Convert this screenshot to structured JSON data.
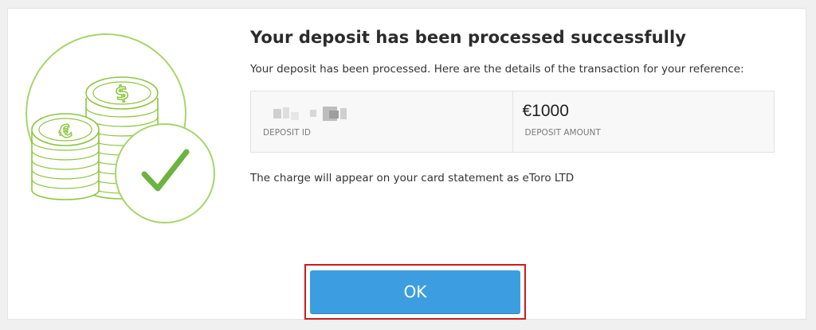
{
  "dialog": {
    "title": "Your deposit has been processed successfully",
    "subtitle": "Your deposit has been processed. Here are the details of the transaction for your reference:",
    "details": {
      "deposit_id_label": "DEPOSIT ID",
      "deposit_id_value": "",
      "deposit_amount_label": "DEPOSIT AMOUNT",
      "deposit_amount_value": "€1000"
    },
    "footnote": "The charge will appear on your card statement as eToro LTD",
    "ok_label": "OK"
  },
  "illustration": {
    "icons": [
      "coin-stack-icon",
      "dollar-sign-icon",
      "euro-sign-icon",
      "checkmark-icon"
    ],
    "accent_color": "#8cc63f",
    "check_color": "#6db33f"
  },
  "colors": {
    "button": "#3c9ee0",
    "highlight_border": "#d11a1a",
    "panel_bg": "#f8f8f8"
  }
}
